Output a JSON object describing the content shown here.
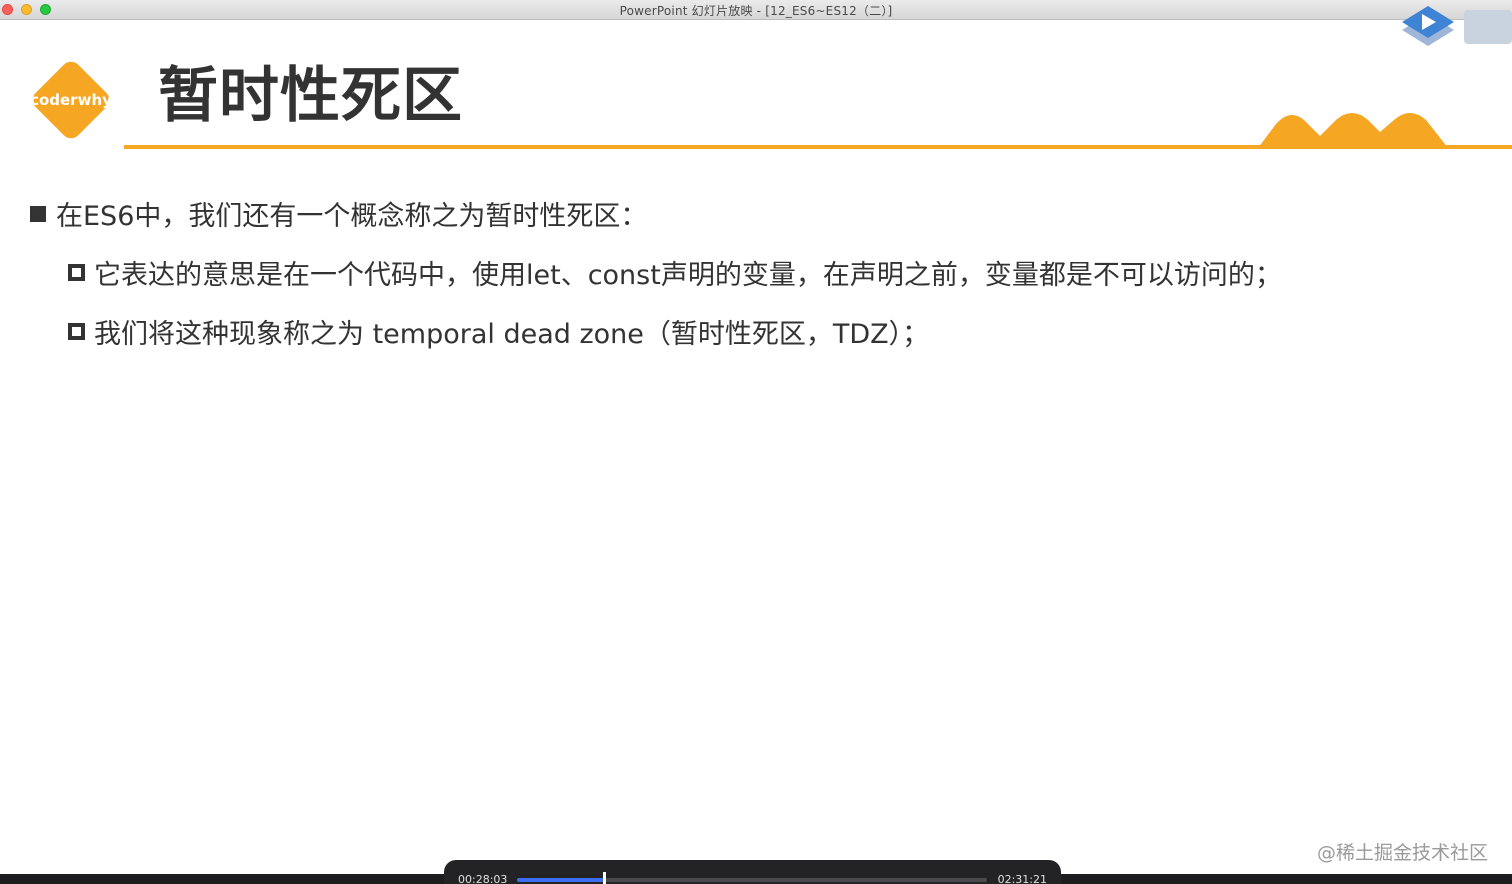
{
  "window": {
    "title": "PowerPoint 幻灯片放映 - [12_ES6~ES12（二）]"
  },
  "slide": {
    "logo_text": "coderwhy",
    "title": "暂时性死区",
    "bullets": [
      {
        "level": 1,
        "text": "在ES6中，我们还有一个概念称之为暂时性死区："
      },
      {
        "level": 2,
        "text": "它表达的意思是在一个代码中，使用let、const声明的变量，在声明之前，变量都是不可以访问的；"
      },
      {
        "level": 2,
        "text": "我们将这种现象称之为 temporal dead zone（暂时性死区，TDZ）；"
      }
    ]
  },
  "watermark": "@稀土掘金技术社区",
  "player": {
    "current_time": "00:28:03",
    "total_time": "02:31:21",
    "progress": 0.185
  },
  "colors": {
    "accent": "#f5a623",
    "text": "#333333",
    "progress": "#3d6df2"
  },
  "icons": {
    "logo": "coderwhy-diamond-logo",
    "brand": "play-triangle-brand-icon",
    "decor": "mountain-peaks-decoration"
  }
}
